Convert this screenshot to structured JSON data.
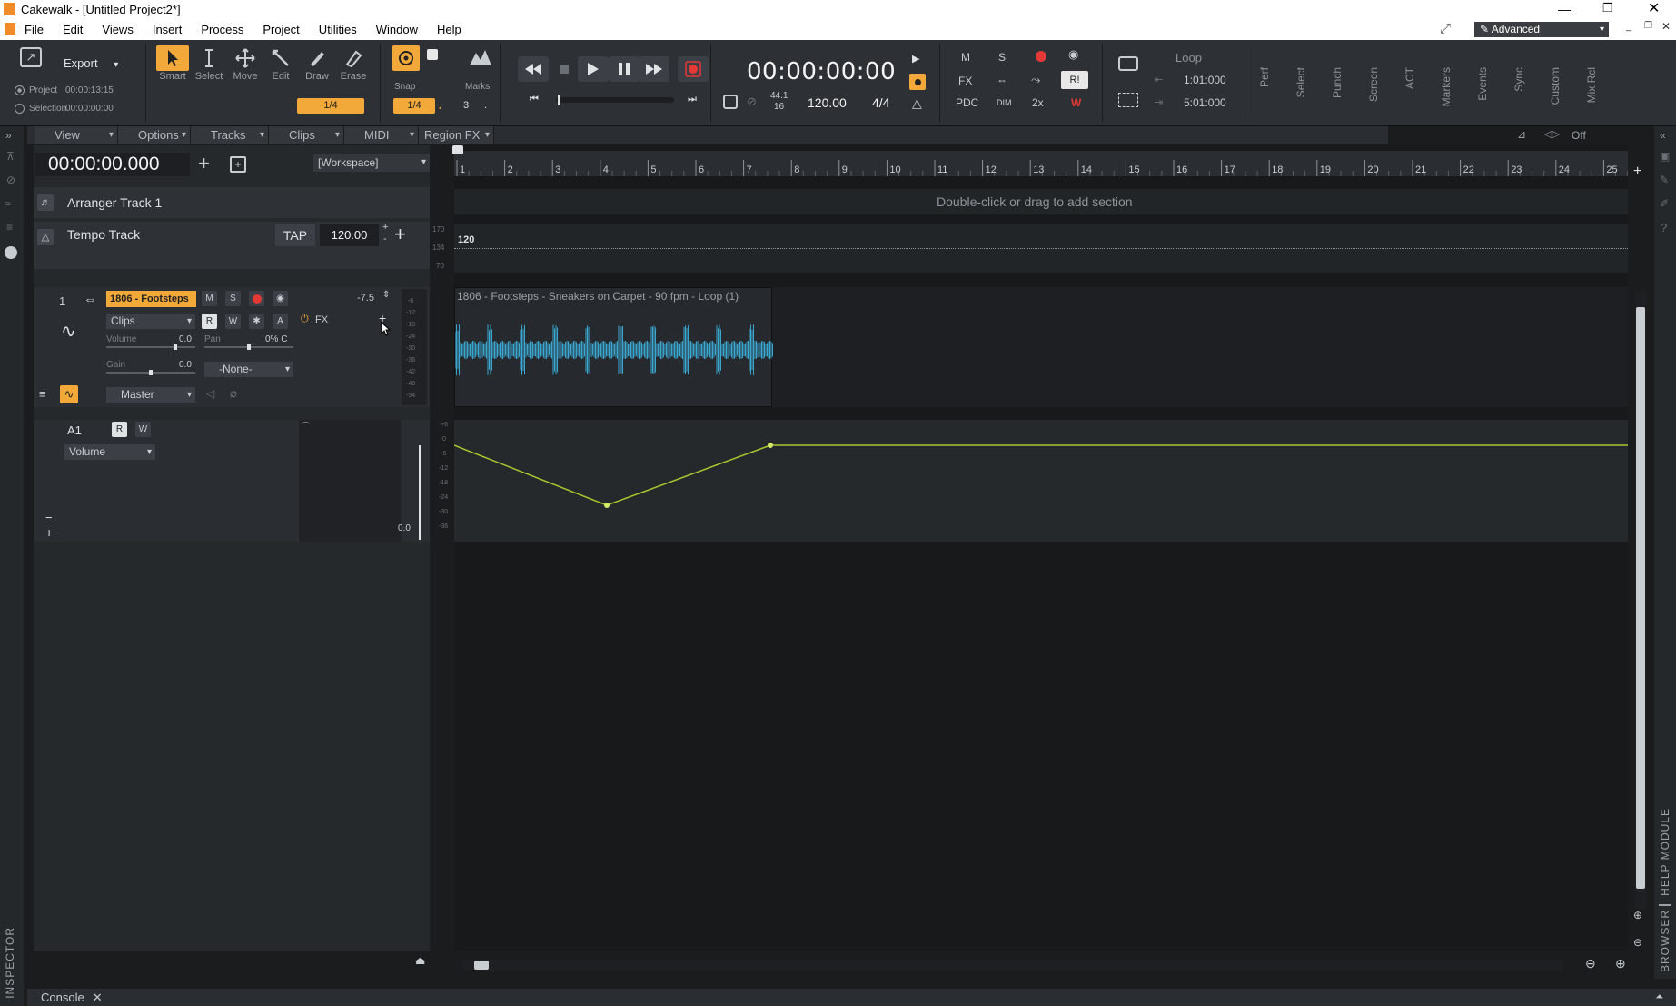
{
  "title": {
    "app_title": "Cakewalk - [Untitled Project2*]"
  },
  "menu": [
    "File",
    "Edit",
    "Views",
    "Insert",
    "Process",
    "Project",
    "Utilities",
    "Window",
    "Help"
  ],
  "workspace": "Advanced",
  "control": {
    "export_label": "Export",
    "project_label": "Project",
    "project_time": "00:00:13:15",
    "selection_label": "Selection",
    "selection_time": "00:00:00:00",
    "tools": [
      "Smart",
      "Select",
      "Move",
      "Edit",
      "Draw",
      "Erase"
    ],
    "tool_snap": "1/4",
    "snap_label": "Snap",
    "marks_label": "Marks",
    "snap_value": "1/4",
    "snap_num": "3",
    "transport_time": "00:00:00:00",
    "sample_rate": "44.1",
    "bit_depth": "16",
    "tempo": "120.00",
    "meter": "4/4",
    "mix_m": "M",
    "mix_s": "S",
    "mix_fx": "FX",
    "mix_pdc": "PDC",
    "mix_dim": "DIM",
    "mix_2x": "2x",
    "mix_r": "R!",
    "mix_w": "W",
    "loop_label": "Loop",
    "loop_start": "1:01:000",
    "loop_end": "5:01:000",
    "modules": [
      "Perf",
      "Select",
      "Punch",
      "Screen",
      "ACT",
      "Markers",
      "Events",
      "Sync",
      "Custom",
      "Mix Rcl"
    ]
  },
  "trackview": {
    "menus": [
      "View",
      "Options",
      "Tracks",
      "Clips",
      "MIDI",
      "Region FX"
    ],
    "now_time": "00:00:00.000",
    "workspace_dd": "[Workspace]",
    "snap_off": "Off"
  },
  "ruler": {
    "bars": [
      "1",
      "2",
      "3",
      "4",
      "5",
      "6",
      "7",
      "8",
      "9",
      "10",
      "11",
      "12",
      "13",
      "14",
      "15",
      "16",
      "17",
      "18",
      "19",
      "20",
      "21",
      "22",
      "23",
      "24",
      "25"
    ]
  },
  "arranger": {
    "name": "Arranger Track 1",
    "hint": "Double-click or drag to add section"
  },
  "tempo_track": {
    "name": "Tempo Track",
    "tap": "TAP",
    "value": "120.00",
    "clip_value": "120",
    "scale": [
      "170",
      "134",
      "70"
    ]
  },
  "track1": {
    "number": "1",
    "name": "1806 - Footsteps",
    "m": "M",
    "s": "S",
    "r": "R",
    "w": "W",
    "a": "A",
    "meter_value": "-7.5",
    "clips_dd": "Clips",
    "fx_label": "FX",
    "volume_label": "Volume",
    "volume_value": "0.0",
    "pan_label": "Pan",
    "pan_value": "0% C",
    "gain_label": "Gain",
    "gain_value": "0.0",
    "input_dd": "-None-",
    "output_dd": "Master",
    "meter_scale": [
      "-6",
      "-12",
      "-18",
      "-24",
      "-30",
      "-36",
      "-42",
      "-48",
      "-54"
    ],
    "clip_title": "1806 - Footsteps - Sneakers on Carpet - 90 fpm - Loop (1)"
  },
  "automation": {
    "lane": "A1",
    "r": "R",
    "w": "W",
    "param": "Volume",
    "value": "0.0",
    "scale": [
      "+6",
      "0",
      "-6",
      "-12",
      "-18",
      "-24",
      "-30",
      "-36"
    ]
  },
  "panels": {
    "inspector": "INSPECTOR",
    "browser": "BROWSER",
    "help_module": "HELP MODULE",
    "console": "Console"
  },
  "colors": {
    "accent": "#f3a93a",
    "waveform": "#3aa7d1",
    "envelope": "#a8c62e",
    "record": "#e53935"
  }
}
